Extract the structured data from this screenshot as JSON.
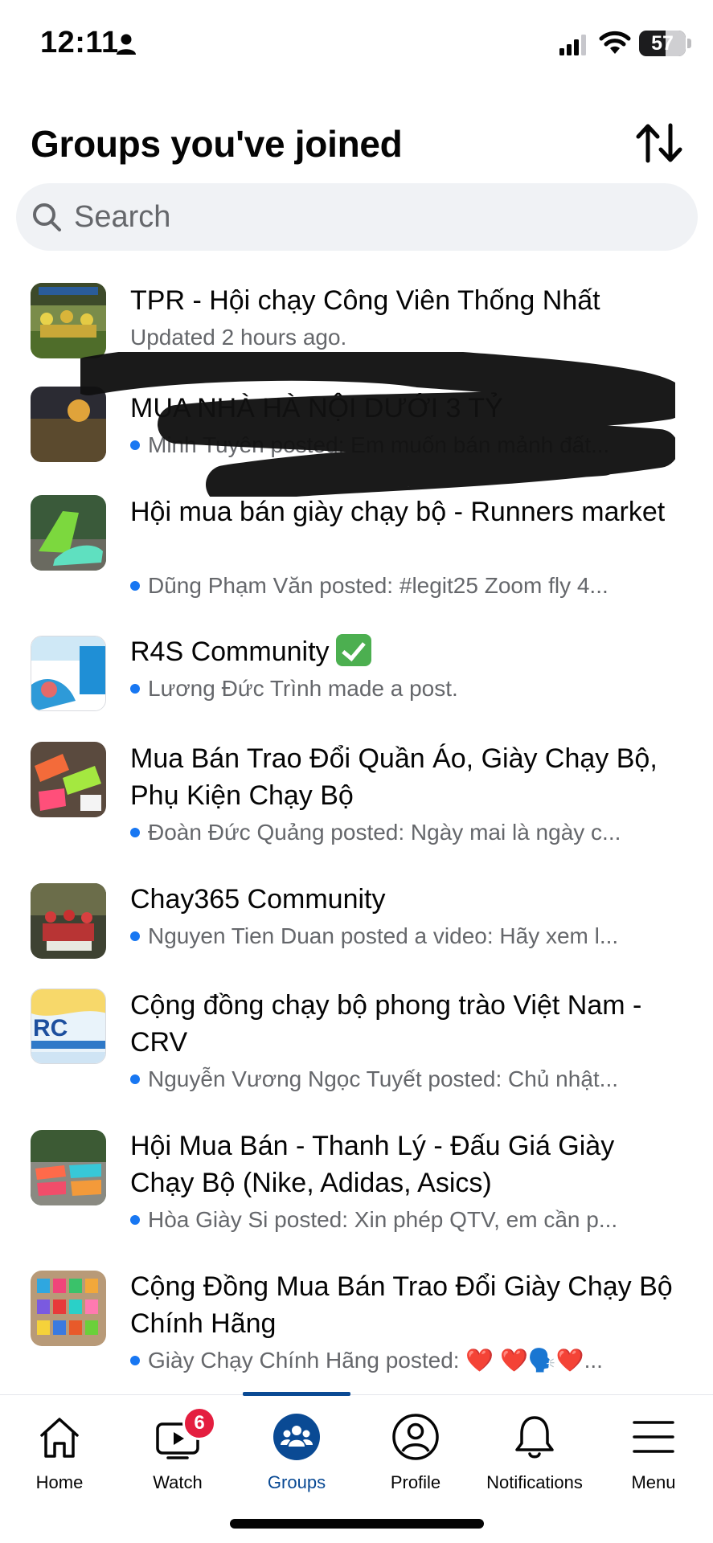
{
  "status_bar": {
    "time": "12:11",
    "battery": "57",
    "battery_level": 0.57
  },
  "header": {
    "title": "Groups you've joined",
    "sort_icon": "sort-arrows-icon"
  },
  "search": {
    "placeholder": "Search",
    "value": ""
  },
  "groups": [
    {
      "name": "TPR - Hội chạy Công Viên Thống Nhất",
      "meta": "Updated 2 hours ago.",
      "unread": false
    },
    {
      "name": "MUA NHÀ HÀ NỘI DƯỚI 3 TỶ",
      "meta": "Minh Tuyên posted: Em muốn bán mảnh đất...",
      "unread": true,
      "redacted": true
    },
    {
      "name": "Hội mua bán giày chạy bộ - Runners market",
      "meta": "Dũng Phạm Văn posted: #legit25 Zoom fly 4...",
      "unread": true
    },
    {
      "name": "R4S Community",
      "meta": "Lương Đức Trình made a post.",
      "unread": true,
      "verified_emoji": "check-mark-button-emoji"
    },
    {
      "name": "Mua Bán Trao Đổi Quần Áo, Giày Chạy Bộ, Phụ Kiện Chạy Bộ",
      "meta": "Đoàn Đức Quảng posted: Ngày mai là ngày c...",
      "unread": true
    },
    {
      "name": "Chay365 Community",
      "meta": "Nguyen Tien Duan posted a video: Hãy xem l...",
      "unread": true
    },
    {
      "name": "Cộng đồng chạy bộ phong trào Việt Nam - CRV",
      "meta": "Nguyễn Vương Ngọc Tuyết posted: Chủ nhật...",
      "unread": true
    },
    {
      "name": "Hội Mua Bán - Thanh Lý - Đấu Giá Giày Chạy Bộ (Nike, Adidas, Asics)",
      "meta": "Hòa Giày Si posted: Xin phép QTV, em cần p...",
      "unread": true
    },
    {
      "name": "Cộng Đồng Mua Bán Trao Đổi Giày Chạy Bộ Chính Hãng",
      "meta": "Giày Chạy Chính Hãng posted: ❤️ ❤️🗣️❤️...",
      "unread": true
    }
  ],
  "nav": {
    "items": [
      {
        "label": "Home",
        "icon": "home-icon"
      },
      {
        "label": "Watch",
        "icon": "watch-icon",
        "badge": "6"
      },
      {
        "label": "Groups",
        "icon": "groups-icon",
        "active": true
      },
      {
        "label": "Profile",
        "icon": "profile-icon"
      },
      {
        "label": "Notifications",
        "icon": "bell-icon"
      },
      {
        "label": "Menu",
        "icon": "menu-icon"
      }
    ]
  },
  "colors": {
    "accent": "#0a4a94",
    "badge": "#e41e3f",
    "unread_dot": "#1877f2",
    "secondary_text": "#65676b",
    "search_bg": "#f0f2f5"
  }
}
